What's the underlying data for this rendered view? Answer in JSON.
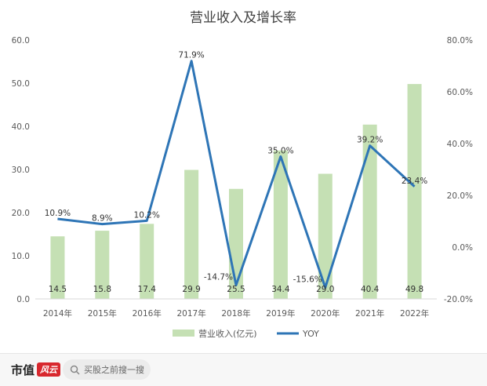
{
  "chart_data": {
    "type": "bar+line",
    "title": "营业收入及增长率",
    "categories": [
      "2014年",
      "2015年",
      "2016年",
      "2017年",
      "2018年",
      "2019年",
      "2020年",
      "2021年",
      "2022年"
    ],
    "series": [
      {
        "name": "营业收入(亿元)",
        "type": "bar",
        "axis": "left",
        "color": "#c5e0b4",
        "values": [
          14.5,
          15.8,
          17.4,
          29.9,
          25.5,
          34.4,
          29.0,
          40.4,
          49.8
        ],
        "labels": [
          "14.5",
          "15.8",
          "17.4",
          "29.9",
          "25.5",
          "34.4",
          "29.0",
          "40.4",
          "49.8"
        ]
      },
      {
        "name": "YOY",
        "type": "line",
        "axis": "right",
        "color": "#2e75b6",
        "values": [
          10.9,
          8.9,
          10.2,
          71.9,
          -14.7,
          35.0,
          -15.6,
          39.2,
          23.4
        ],
        "labels": [
          "10.9%",
          "8.9%",
          "10.2%",
          "71.9%",
          "-14.7%",
          "35.0%",
          "-15.6%",
          "39.2%",
          "23.4%"
        ]
      }
    ],
    "left_axis": {
      "range": [
        0,
        60
      ],
      "ticks": [
        "0.0",
        "10.0",
        "20.0",
        "30.0",
        "40.0",
        "50.0",
        "60.0"
      ]
    },
    "right_axis": {
      "range": [
        -20,
        80
      ],
      "ticks": [
        "-20.0%",
        "0.0%",
        "20.0%",
        "40.0%",
        "60.0%",
        "80.0%"
      ]
    },
    "grid": false,
    "legend_position": "bottom"
  },
  "footer": {
    "brand": "市值",
    "brand_mark": "风云",
    "search_placeholder": "买股之前搜一搜",
    "icon": "search-icon"
  }
}
